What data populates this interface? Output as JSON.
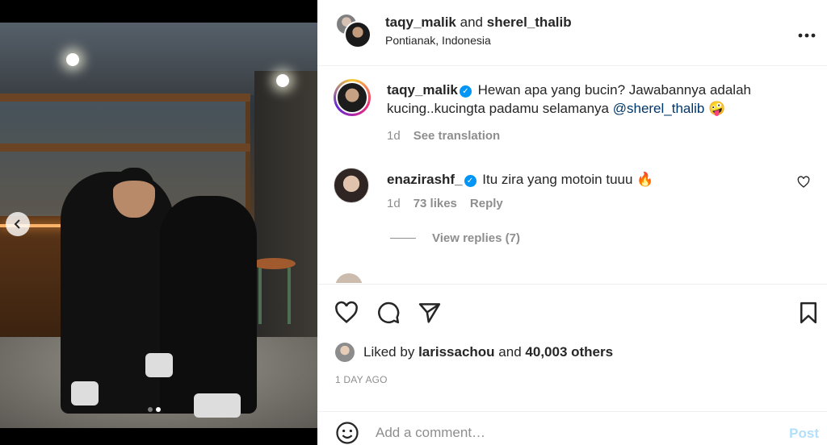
{
  "post": {
    "header": {
      "user1": "taqy_malik",
      "connector": "and",
      "user2": "sherel_thalib",
      "location": "Pontianak, Indonesia",
      "more_icon": "more-horizontal-icon"
    },
    "caption": {
      "username": "taqy_malik",
      "text": "Hewan apa yang bucin? Jawabannya adalah kucing..kucingta padamu selamanya",
      "mention": "@sherel_thalib",
      "emoji": "🤪",
      "time": "1d",
      "translate_label": "See translation"
    },
    "comments": [
      {
        "username": "enazirashf_",
        "text": "Itu zira yang motoin tuuu",
        "emoji": "🔥",
        "time": "1d",
        "likes": "73 likes",
        "reply_label": "Reply",
        "view_replies": "View replies (7)"
      }
    ],
    "actions": {
      "like_icon": "heart-icon",
      "comment_icon": "comment-icon",
      "share_icon": "send-icon",
      "save_icon": "bookmark-icon"
    },
    "likes": {
      "prefix": "Liked by",
      "user": "larissachou",
      "conjunction": "and",
      "count": "40,003 others"
    },
    "timestamp": "1 DAY AGO",
    "add_comment": {
      "placeholder": "Add a comment…",
      "post_label": "Post"
    },
    "carousel": {
      "total": 2,
      "active_index": 2
    }
  },
  "colors": {
    "link": "#00376b",
    "verified": "#0095f6",
    "post_disabled": "#b2dffc",
    "muted": "#8e8e8e"
  }
}
